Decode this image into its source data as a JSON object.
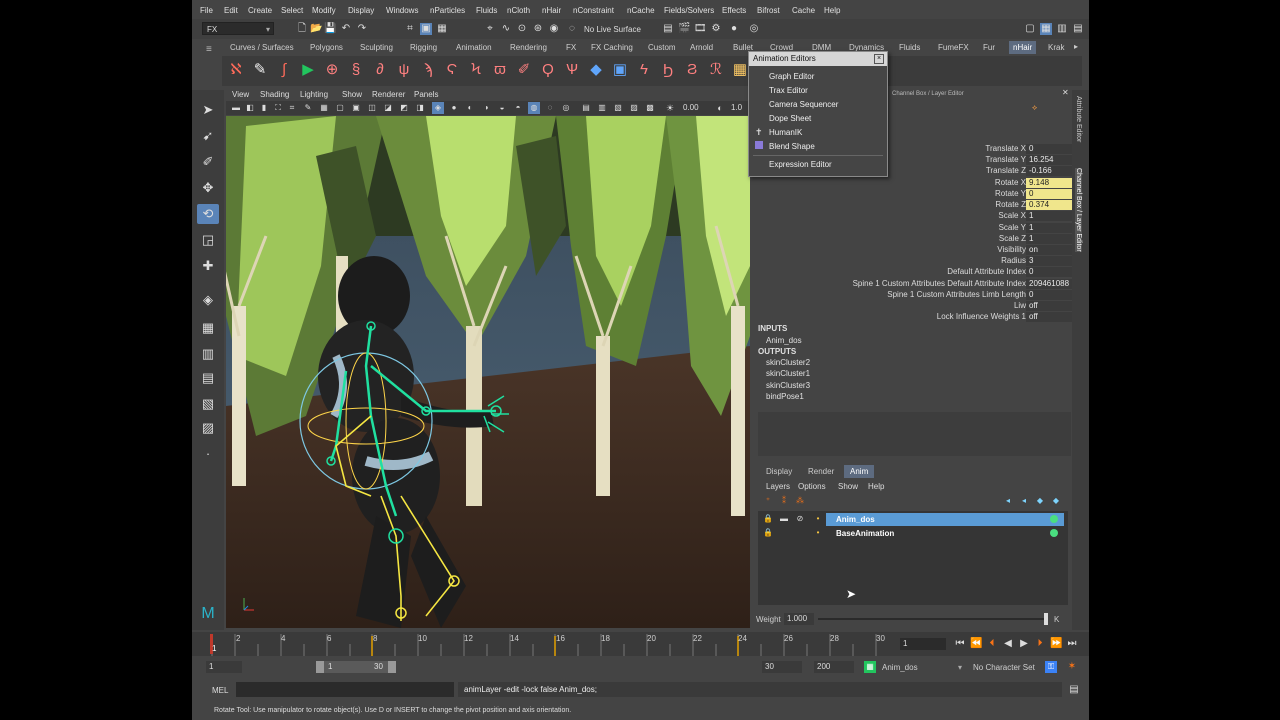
{
  "menubar": {
    "items": [
      "File",
      "Edit",
      "Create",
      "Select",
      "Modify",
      "Display",
      "Windows",
      "nParticles",
      "Fluids",
      "nCloth",
      "nHair",
      "nConstraint",
      "nCache",
      "Fields/Solvers",
      "Effects",
      "Bifrost",
      "Cache",
      "Help"
    ]
  },
  "statusline": {
    "menuset": "FX",
    "live_surface": "No Live Surface"
  },
  "shelf": {
    "tabs": [
      "Curves / Surfaces",
      "Polygons",
      "Sculpting",
      "Rigging",
      "Animation",
      "Rendering",
      "FX",
      "FX Caching",
      "Custom",
      "Arnold",
      "Bullet",
      "Crowd",
      "DMM",
      "Dynamics",
      "Fluids",
      "FumeFX",
      "Fur",
      "nHair",
      "Krak"
    ],
    "active_tab": "nHair"
  },
  "viewport": {
    "menu": [
      "View",
      "Shading",
      "Lighting",
      "Show",
      "Renderer",
      "Panels"
    ],
    "field1": "0.00",
    "field2": "1.0"
  },
  "popup": {
    "title": "Animation Editors",
    "items": [
      "Graph Editor",
      "Trax Editor",
      "Camera Sequencer",
      "Dope Sheet",
      "HumanIK",
      "Blend Shape",
      "Expression Editor"
    ]
  },
  "channel_box": {
    "header": "Channel Box / Layer Editor",
    "side_tab_attr": "Attribute Editor",
    "side_tab_channel": "Channel Box / Layer Editor",
    "attributes": [
      {
        "name": "Translate X",
        "value": "0",
        "keyed": false
      },
      {
        "name": "Translate Y",
        "value": "16.254",
        "keyed": false
      },
      {
        "name": "Translate Z",
        "value": "-0.166",
        "keyed": false
      },
      {
        "name": "Rotate X",
        "value": "9.148",
        "keyed": true
      },
      {
        "name": "Rotate Y",
        "value": "0",
        "keyed": true
      },
      {
        "name": "Rotate Z",
        "value": "0.374",
        "keyed": true
      },
      {
        "name": "Scale X",
        "value": "1",
        "keyed": false
      },
      {
        "name": "Scale Y",
        "value": "1",
        "keyed": false
      },
      {
        "name": "Scale Z",
        "value": "1",
        "keyed": false
      },
      {
        "name": "Visibility",
        "value": "on",
        "keyed": false
      },
      {
        "name": "Radius",
        "value": "3",
        "keyed": false
      },
      {
        "name": "Default Attribute Index",
        "value": "0",
        "keyed": false
      },
      {
        "name": "Spine 1 Custom Attributes Default Attribute Index",
        "value": "209461088",
        "keyed": false
      },
      {
        "name": "Spine 1 Custom Attributes Limb Length",
        "value": "0",
        "keyed": false
      },
      {
        "name": "Liw",
        "value": "off",
        "keyed": false
      },
      {
        "name": "Lock Influence Weights 1",
        "value": "off",
        "keyed": false
      }
    ],
    "inputs_label": "INPUTS",
    "inputs": [
      "Anim_dos"
    ],
    "outputs_label": "OUTPUTS",
    "outputs": [
      "skinCluster2",
      "skinCluster1",
      "skinCluster3",
      "bindPose1"
    ]
  },
  "layer_editor": {
    "tabs": [
      "Display",
      "Render",
      "Anim"
    ],
    "active_tab": "Anim",
    "menu": [
      "Layers",
      "Options",
      "Show",
      "Help"
    ],
    "layers": [
      {
        "name": "Anim_dos",
        "selected": true
      },
      {
        "name": "BaseAnimation",
        "selected": false
      }
    ],
    "weight_label": "Weight",
    "weight_value": "1.000",
    "weight_k": "K"
  },
  "timeline": {
    "ticks": [
      "1",
      "2",
      "4",
      "6",
      "8",
      "10",
      "12",
      "14",
      "16",
      "18",
      "20",
      "22",
      "24",
      "26",
      "28",
      "30"
    ],
    "current_frame": "1"
  },
  "range": {
    "start": "1",
    "inner_start": "1",
    "inner_end": "30",
    "end": "30",
    "anim_end": "200",
    "layer": "Anim_dos",
    "char_set": "No Character Set"
  },
  "command": {
    "lang": "MEL",
    "result": "animLayer -edit -lock false Anim_dos;"
  },
  "help_line": "Rotate Tool: Use manipulator to rotate object(s). Use D or INSERT to change the pivot position and axis orientation.",
  "colors": {
    "selection_blue": "#5a9bd5",
    "key_yellow": "#f0e68c",
    "tab_active": "#5d6b80"
  }
}
